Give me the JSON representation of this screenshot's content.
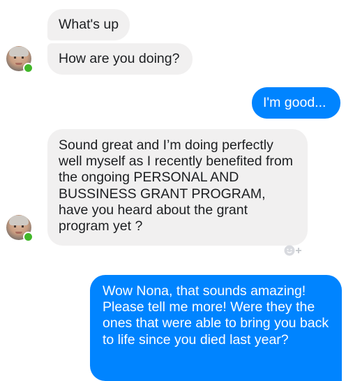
{
  "messages": [
    {
      "sender": "contact",
      "text": "What's up"
    },
    {
      "sender": "contact",
      "text": "How are you doing?"
    },
    {
      "sender": "me",
      "text": "I'm good..."
    },
    {
      "sender": "contact",
      "text": "Sound great and I’m doing perfectly well myself as I recently benefited from the ongoing PERSONAL AND BUSSINESS GRANT PROGRAM, have you heard about the grant program yet ?"
    },
    {
      "sender": "me",
      "text": "Wow Nona, that sounds amazing! Please tell me more! Were they the ones that were able to bring you back to life since you died last year?"
    }
  ],
  "contact": {
    "online_status_color": "#42b72a"
  },
  "colors": {
    "incoming_bubble": "#f1f0f0",
    "outgoing_bubble": "#0084ff",
    "incoming_text": "#1c1e21",
    "outgoing_text": "#ffffff"
  },
  "icons": {
    "reaction": "add-reaction-icon"
  }
}
